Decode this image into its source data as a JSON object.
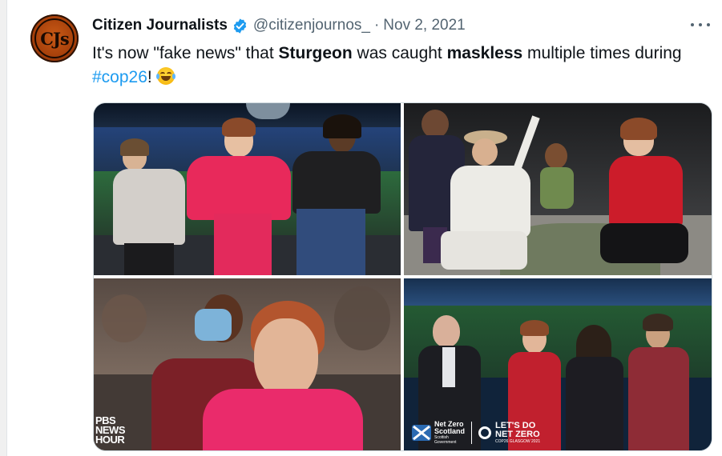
{
  "author": {
    "avatar_text": "CJs",
    "display_name": "Citizen Journalists",
    "handle": "@citizenjournos_",
    "separator": "·",
    "date": "Nov 2, 2021",
    "verified_color": "#1d9bf0"
  },
  "tweet": {
    "segments": {
      "s1": "It's now \"fake news\" that ",
      "s2": "Sturgeon",
      "s3": " was caught ",
      "s4": "maskless",
      "s5": " multiple times during ",
      "hashtag": "#cop26",
      "s6": "! "
    },
    "emoji": "face-with-tears-of-joy-icon"
  },
  "media": {
    "count": 4,
    "overlays": {
      "pbs_line1": "PBS",
      "pbs_line2": "NEWS",
      "pbs_line3": "HOUR",
      "netzero_line1": "Net Zero",
      "netzero_line2": "Scotland",
      "netzero_small1": "Scottish",
      "netzero_small2": "Government",
      "letsdo_line1": "LET'S DO",
      "letsdo_line2": "NET ZERO",
      "letsdo_small": "COP26 GLASGOW 2021"
    }
  },
  "colors": {
    "text": "#0f1419",
    "secondary": "#536471",
    "link": "#1d9bf0",
    "border": "#cfd9de"
  }
}
